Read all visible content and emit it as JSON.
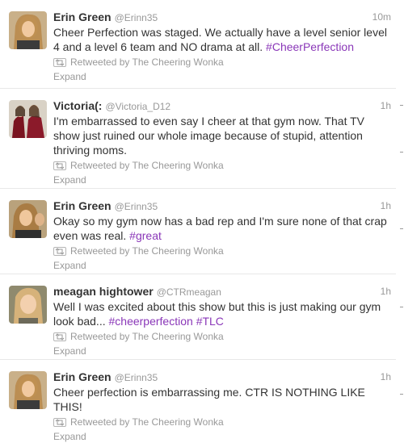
{
  "tweets": [
    {
      "name": "Erin Green",
      "handle": "@Erinn35",
      "time": "10m",
      "text_parts": [
        "Cheer Perfection was staged. We actually have a level senior level 4 and a level 6 team and NO drama at all. "
      ],
      "hashtags": [
        "#CheerPerfection"
      ],
      "retweet_label": "Retweeted by The Cheering Wonka",
      "expand_label": "Expand"
    },
    {
      "name": "Victoria(:",
      "handle": "@Victoria_D12",
      "time": "1h",
      "text_parts": [
        "I'm embarrassed to even say I cheer at that gym now. That TV show just ruined our whole image because of stupid, attention thriving moms."
      ],
      "hashtags": [],
      "retweet_label": "Retweeted by The Cheering Wonka",
      "expand_label": "Expand"
    },
    {
      "name": "Erin Green",
      "handle": "@Erinn35",
      "time": "1h",
      "text_parts": [
        "Okay so my gym now has a bad rep and I'm sure none of that crap even was real. "
      ],
      "hashtags": [
        "#great"
      ],
      "retweet_label": "Retweeted by The Cheering Wonka",
      "expand_label": "Expand"
    },
    {
      "name": "meagan hightower",
      "handle": "@CTRmeagan",
      "time": "1h",
      "text_parts": [
        "Well I was excited about this show but this is just making our gym look bad... "
      ],
      "hashtags": [
        "#cheerperfection",
        "#TLC"
      ],
      "retweet_label": "Retweeted by The Cheering Wonka",
      "expand_label": "Expand"
    },
    {
      "name": "Erin Green",
      "handle": "@Erinn35",
      "time": "1h",
      "text_parts": [
        "Cheer perfection is embarrassing me. CTR IS NOTHING LIKE THIS!"
      ],
      "hashtags": [],
      "retweet_label": "Retweeted by The Cheering Wonka",
      "expand_label": "Expand"
    }
  ],
  "colors": {
    "hashtag": "#8a37b8",
    "meta": "#999999",
    "text": "#333333"
  },
  "icons": {
    "retweet": "retweet-icon"
  }
}
